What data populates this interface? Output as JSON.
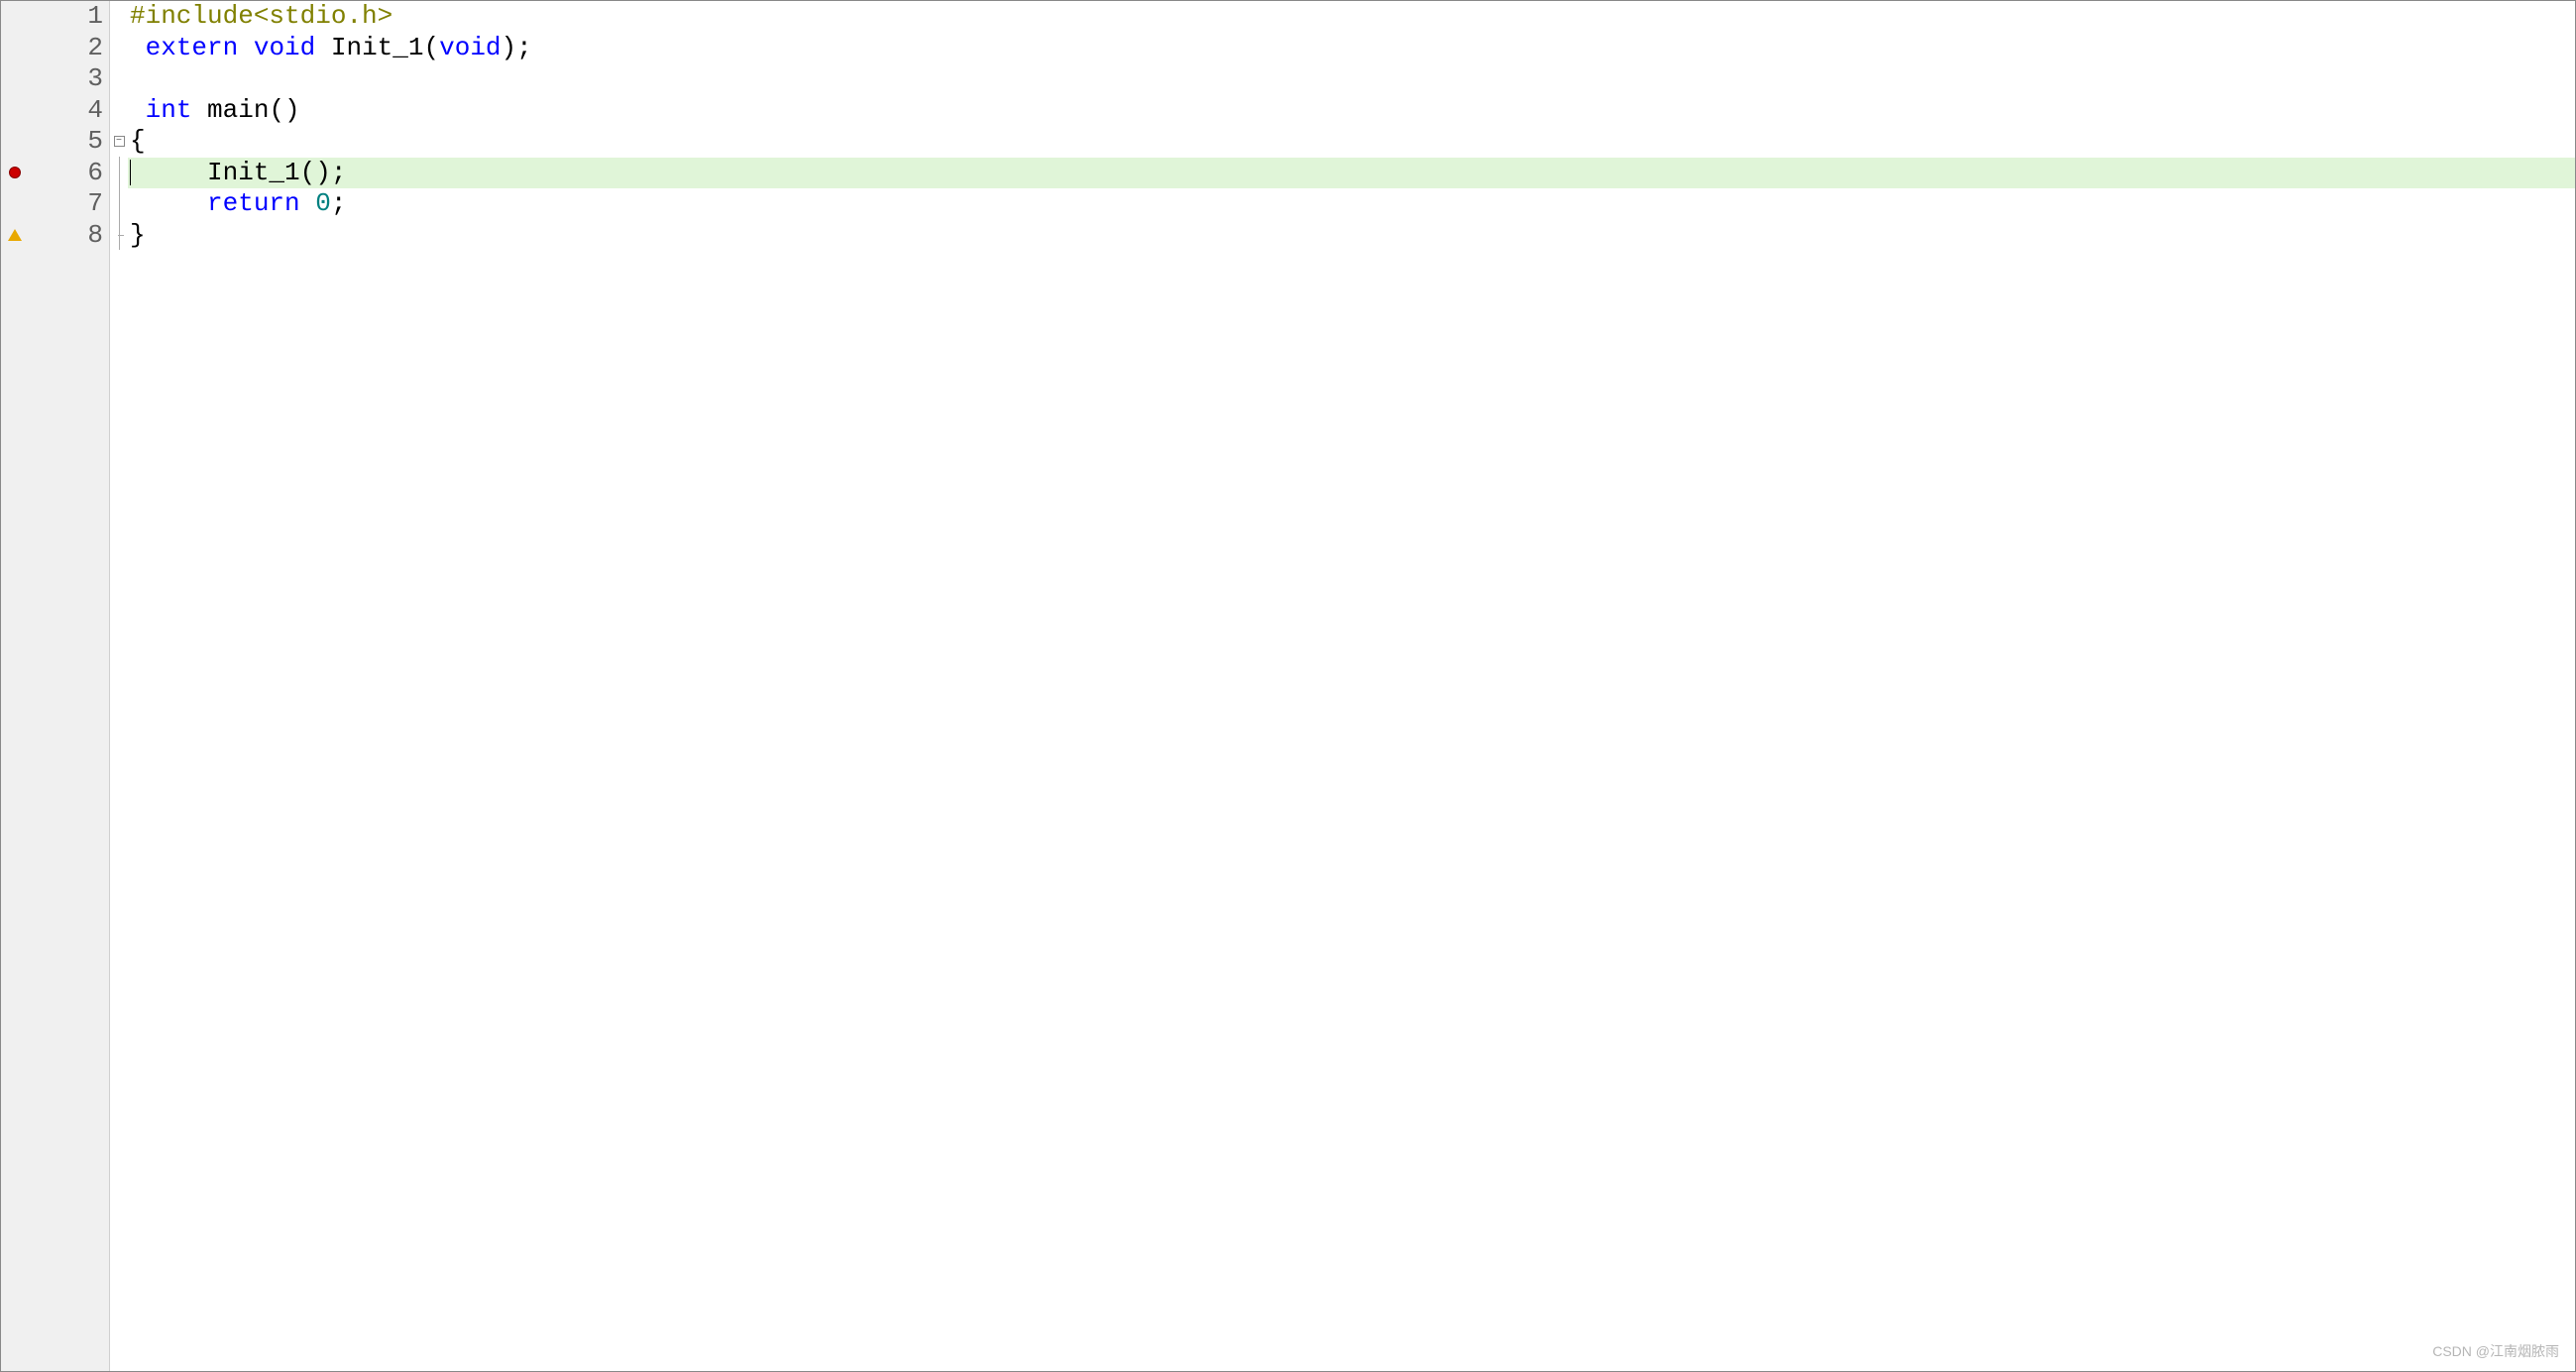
{
  "editor": {
    "lineCount": 8,
    "highlightedLine": 6,
    "markers": {
      "6": "breakpoint",
      "8": "warning"
    },
    "fold": {
      "start": 5,
      "end": 8,
      "symbol": "−"
    },
    "lineNumbers": [
      "1",
      "2",
      "3",
      "4",
      "5",
      "6",
      "7",
      "8"
    ],
    "code": {
      "line1": {
        "preproc": "#include",
        "string": "<stdio.h>"
      },
      "line2": {
        "indent": " ",
        "kw1": "extern",
        "sp1": " ",
        "kw2": "void",
        "sp2": " ",
        "ident": "Init_1",
        "p1": "(",
        "kw3": "void",
        "p2": ")",
        "semi": ";"
      },
      "line3": {
        "content": ""
      },
      "line4": {
        "indent": " ",
        "kw1": "int",
        "sp1": " ",
        "ident": "main",
        "parens": "()"
      },
      "line5": {
        "content": "{"
      },
      "line6": {
        "indent": "     ",
        "ident": "Init_1",
        "call": "();"
      },
      "line7": {
        "indent": "     ",
        "kw1": "return",
        "sp1": " ",
        "num": "0",
        "semi": ";"
      },
      "line8": {
        "content": "}"
      }
    }
  },
  "watermark": "CSDN @江南烟脓雨"
}
